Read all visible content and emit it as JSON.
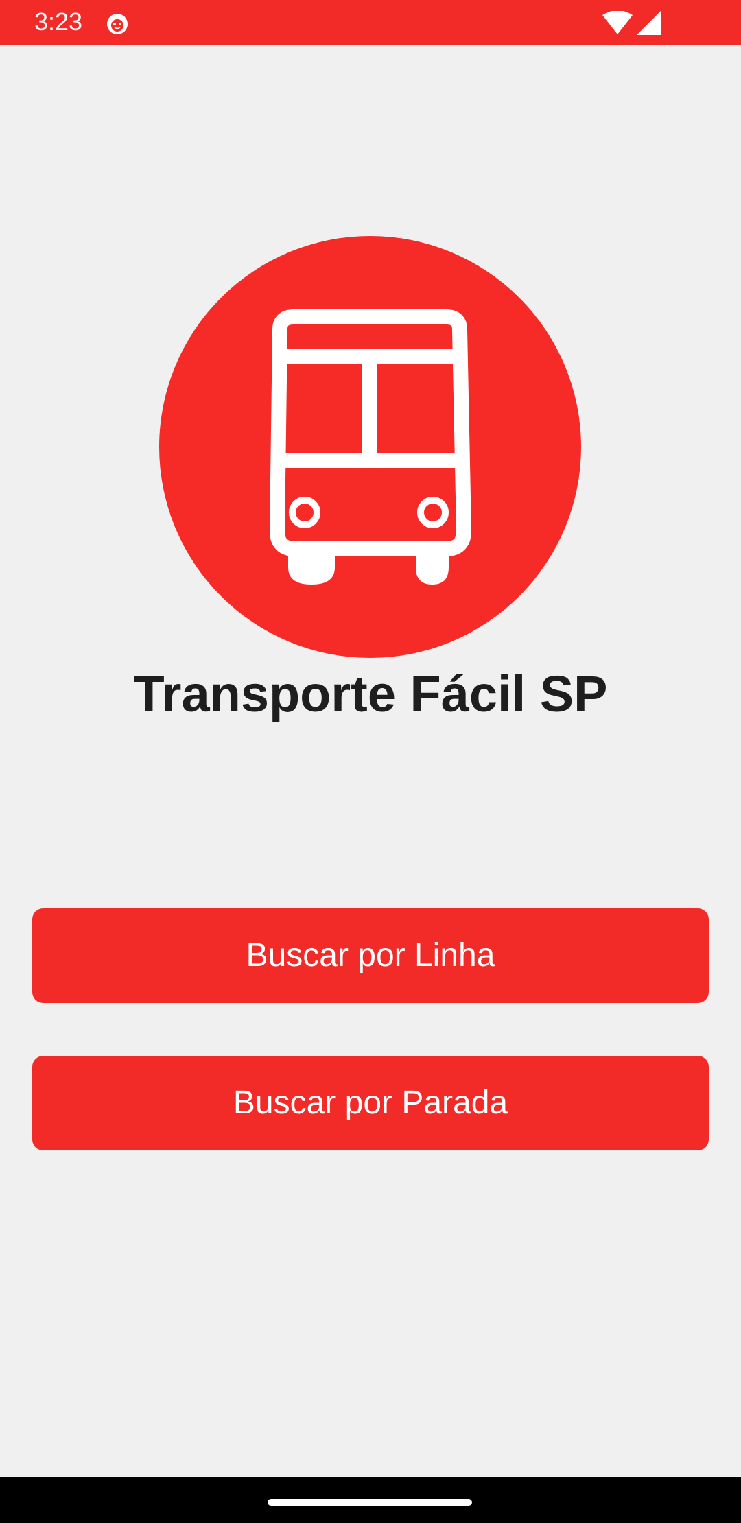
{
  "status_bar": {
    "time": "3:23",
    "app_icon": "cat-face-icon",
    "wifi_icon": "wifi-icon",
    "signal_icon": "cellular-signal-icon",
    "background_color": "#f22b29"
  },
  "logo": {
    "icon": "bus-icon",
    "circle_color": "#f62a27"
  },
  "main": {
    "title": "Transporte Fácil SP",
    "buttons": [
      {
        "label": "Buscar por Linha"
      },
      {
        "label": "Buscar por Parada"
      }
    ],
    "button_color": "#f22b29"
  },
  "nav_bar": {
    "home_indicator": "home-handle"
  }
}
